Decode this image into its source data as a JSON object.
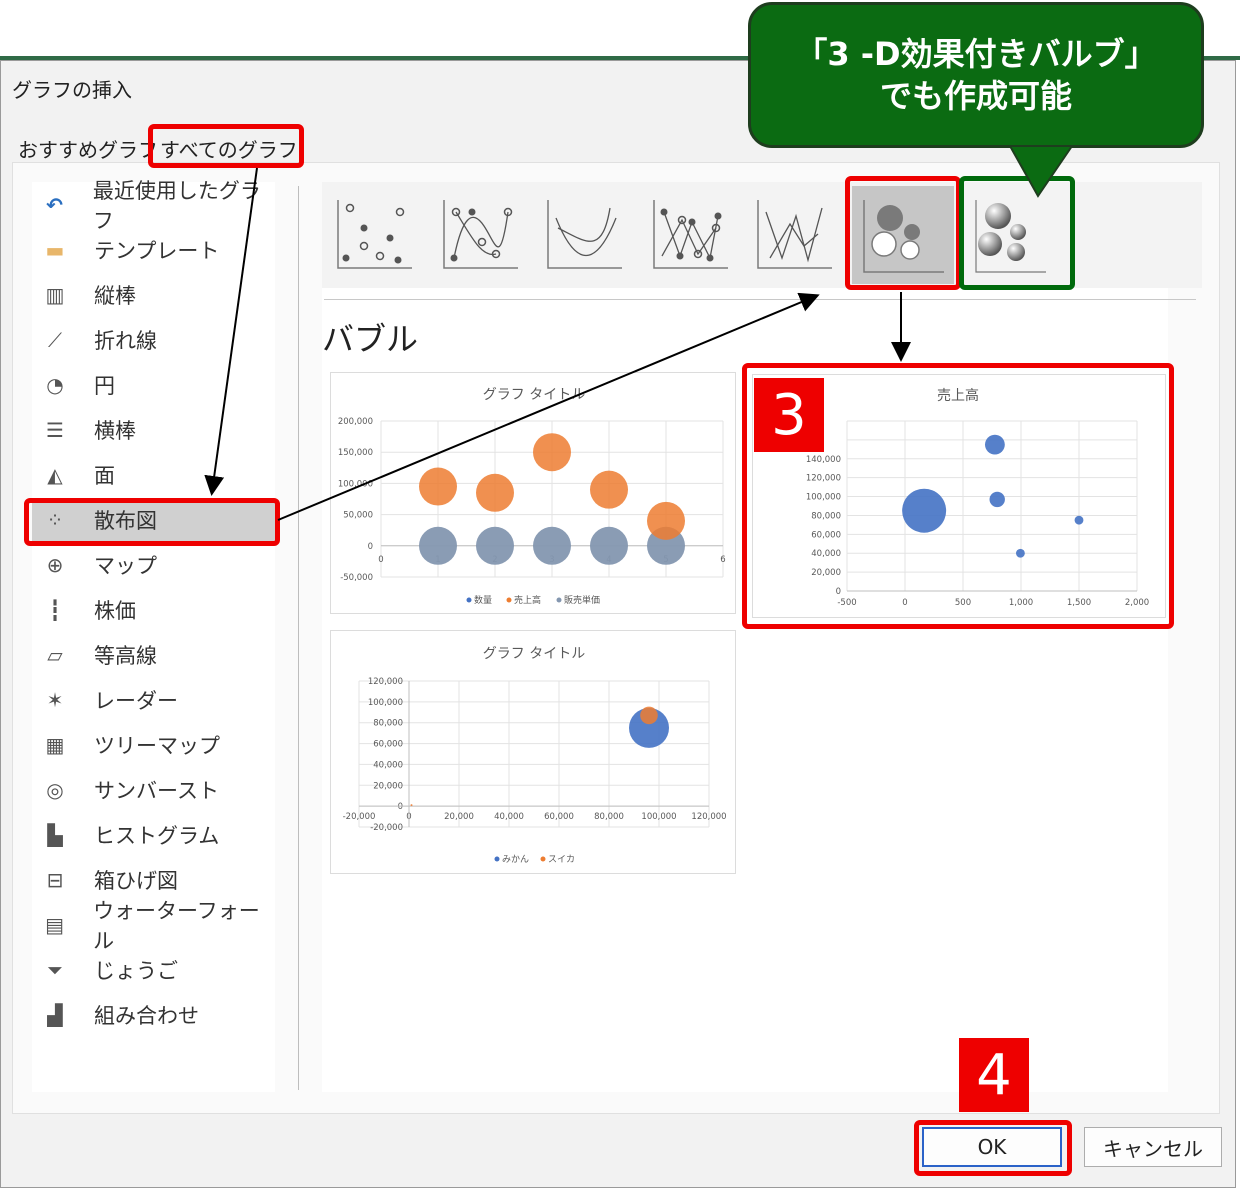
{
  "dialog": {
    "title": "グラフの挿入"
  },
  "tabs": {
    "recommended": "おすすめグラフ",
    "all": "すべてのグラフ"
  },
  "sidebar": {
    "items": [
      {
        "label": "最近使用したグラフ",
        "icon": "recent-icon"
      },
      {
        "label": "テンプレート",
        "icon": "folder-icon"
      },
      {
        "label": "縦棒",
        "icon": "column-chart-icon"
      },
      {
        "label": "折れ線",
        "icon": "line-chart-icon"
      },
      {
        "label": "円",
        "icon": "pie-chart-icon"
      },
      {
        "label": "横棒",
        "icon": "bar-chart-icon"
      },
      {
        "label": "面",
        "icon": "area-chart-icon"
      },
      {
        "label": "散布図",
        "icon": "scatter-chart-icon"
      },
      {
        "label": "マップ",
        "icon": "map-icon"
      },
      {
        "label": "株価",
        "icon": "stock-chart-icon"
      },
      {
        "label": "等高線",
        "icon": "surface-chart-icon"
      },
      {
        "label": "レーダー",
        "icon": "radar-chart-icon"
      },
      {
        "label": "ツリーマップ",
        "icon": "treemap-icon"
      },
      {
        "label": "サンバースト",
        "icon": "sunburst-icon"
      },
      {
        "label": "ヒストグラム",
        "icon": "histogram-icon"
      },
      {
        "label": "箱ひげ図",
        "icon": "box-whisker-icon"
      },
      {
        "label": "ウォーターフォール",
        "icon": "waterfall-icon"
      },
      {
        "label": "じょうご",
        "icon": "funnel-icon"
      },
      {
        "label": "組み合わせ",
        "icon": "combo-chart-icon"
      }
    ],
    "selected": "散布図"
  },
  "section": {
    "title": "バブル"
  },
  "buttons": {
    "ok": "OK",
    "cancel": "キャンセル"
  },
  "annotations": {
    "callout_line1": "「3 -D効果付きバルブ」",
    "callout_line2": "でも作成可能",
    "badge_3": "3",
    "badge_4": "4"
  },
  "colors": {
    "blue": "#4472c4",
    "orange": "#ed7d31",
    "gray": "#8497b0",
    "red": "#ee0000",
    "green": "#006a0c"
  },
  "chart_data": [
    {
      "type": "bubble",
      "title": "グラフ タイトル",
      "x": [
        1,
        2,
        3,
        4,
        5
      ],
      "xlim": [
        0,
        6
      ],
      "x_ticks": [
        "0",
        "1",
        "2",
        "3",
        "4",
        "5",
        "6"
      ],
      "ylim": [
        -50000,
        200000
      ],
      "y_ticks": [
        "-50,000",
        "0",
        "50,000",
        "100,000",
        "150,000",
        "200,000"
      ],
      "series": [
        {
          "name": "数量",
          "values": [
            0,
            0,
            0,
            0,
            0
          ]
        },
        {
          "name": "売上高",
          "values": [
            95000,
            85000,
            150000,
            90000,
            40000
          ]
        },
        {
          "name": "販売単価",
          "values": [
            0,
            0,
            0,
            0,
            0
          ]
        }
      ],
      "legend": "bottom"
    },
    {
      "type": "bubble",
      "title": "売上高",
      "xlim": [
        -500,
        2000
      ],
      "x_ticks": [
        "-500",
        "0",
        "500",
        "1,000",
        "1,500",
        "2,000"
      ],
      "ylim": [
        0,
        180000
      ],
      "y_ticks": [
        "0",
        "20,000",
        "40,000",
        "60,000",
        "80,000",
        "100,000",
        "120,000",
        "140,000"
      ],
      "points": [
        {
          "x": 165,
          "y": 85000,
          "size": 10
        },
        {
          "x": 775,
          "y": 155000,
          "size": 4.5
        },
        {
          "x": 795,
          "y": 97000,
          "size": 3.5
        },
        {
          "x": 995,
          "y": 40000,
          "size": 2
        },
        {
          "x": 1500,
          "y": 75000,
          "size": 2
        }
      ]
    },
    {
      "type": "bubble",
      "title": "グラフ タイトル",
      "xlim": [
        -20000,
        120000
      ],
      "x_ticks": [
        "-20,000",
        "0",
        "20,000",
        "40,000",
        "60,000",
        "80,000",
        "100,000",
        "120,000"
      ],
      "ylim": [
        -20000,
        120000
      ],
      "y_ticks": [
        "-20,000",
        "0",
        "20,000",
        "40,000",
        "60,000",
        "80,000",
        "100,000",
        "120,000"
      ],
      "series": [
        {
          "name": "みかん",
          "points": [
            {
              "x": 96000,
              "y": 75000,
              "size": 10
            }
          ]
        },
        {
          "name": "スイカ",
          "points": [
            {
              "x": 96000,
              "y": 87000,
              "size": 4
            },
            {
              "x": 1000,
              "y": 1000,
              "size": 0.3
            }
          ]
        }
      ],
      "legend": "bottom"
    }
  ]
}
